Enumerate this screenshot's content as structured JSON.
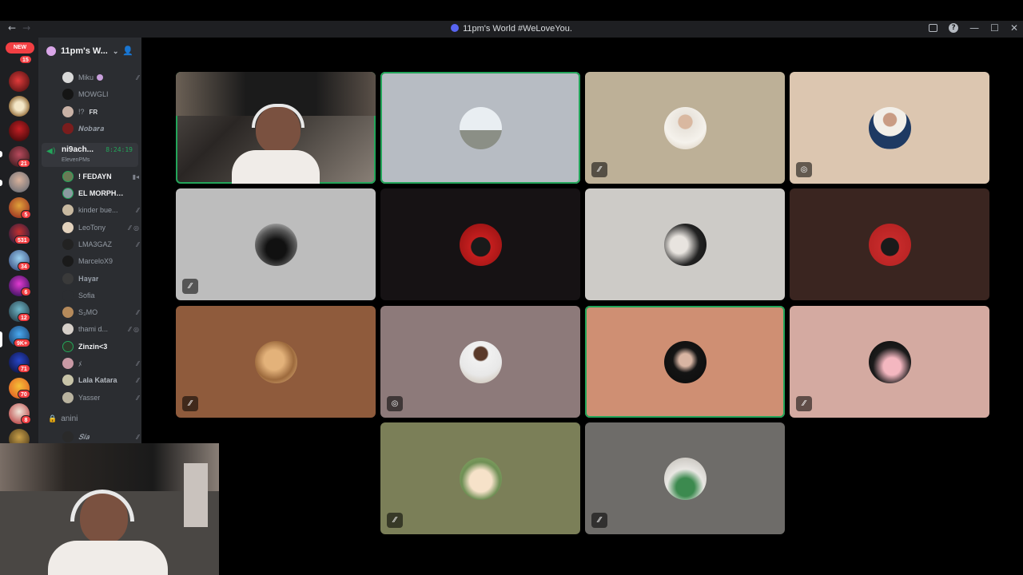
{
  "window": {
    "title": "11pm's World #WeLoveYou.",
    "back": "←",
    "forward": "→",
    "controls": {
      "inbox": "inbox-icon",
      "help": "?",
      "minimize": "—",
      "maximize": "☐",
      "close": "✕"
    }
  },
  "rail": {
    "new_badge": "NEW",
    "counts": [
      "15",
      "21",
      "5",
      "531",
      "34",
      "6",
      "12",
      "9K+",
      "71",
      "70",
      "8"
    ]
  },
  "server": {
    "name": "11pm's W...",
    "chevron": "⌄",
    "invite_icon": "add-user-icon"
  },
  "voice_users_top": [
    {
      "name": "Miku",
      "extra": "",
      "muted": true
    },
    {
      "name": "MOWGLI",
      "extra": "",
      "muted": false
    },
    {
      "name": "!?",
      "extra": "FR",
      "muted": false
    },
    {
      "name": "𝑵𝒐𝒃𝒂𝒓𝒂",
      "extra": "",
      "muted": false
    }
  ],
  "active_channel": {
    "name": "ni9ach...",
    "timer": "8:24:19",
    "subtitle": "ElevenPMs"
  },
  "voice_users": [
    {
      "name": "! FEDAYN",
      "bright": true,
      "icons": [
        "video-icon"
      ]
    },
    {
      "name": "EL MORPHO _",
      "bright": true,
      "icons": []
    },
    {
      "name": "kinder bue...",
      "bright": false,
      "icons": [
        "mic-muted-icon"
      ]
    },
    {
      "name": "LeoTony",
      "bright": false,
      "icons": [
        "mic-muted-icon",
        "deafened-icon"
      ]
    },
    {
      "name": "LMA3GAZ",
      "bright": false,
      "icons": [
        "mic-muted-icon"
      ]
    },
    {
      "name": "MarceloX9",
      "bright": false,
      "icons": []
    },
    {
      "name": "𝐇𝐚𝐲𝐚𝐫",
      "bright": false,
      "icons": []
    },
    {
      "name": "Sofia",
      "bright": false,
      "icons": []
    },
    {
      "name": "S₃MO",
      "bright": false,
      "icons": [
        "mic-muted-icon"
      ]
    },
    {
      "name": "thami d...",
      "bright": false,
      "icons": [
        "mic-muted-icon",
        "deafened-icon"
      ]
    },
    {
      "name": "Zinzin<3",
      "bright": true,
      "icons": []
    },
    {
      "name": "ﾒ",
      "bright": false,
      "icons": [
        "mic-muted-icon"
      ]
    },
    {
      "name": "Lala Katara",
      "bright": false,
      "icons": [
        "mic-muted-icon"
      ]
    },
    {
      "name": "Yasser",
      "bright": false,
      "icons": [
        "mic-muted-icon"
      ]
    }
  ],
  "locked_channel": {
    "name": "anini",
    "lock_icon": "lock-icon"
  },
  "bottom_user": {
    "name": "𝑺𝒊𝒂",
    "icon": "mic-muted-icon"
  },
  "tiles": [
    {
      "kind": "video",
      "speaking": true,
      "muted": false,
      "bg": "#3b3a36"
    },
    {
      "kind": "avatar",
      "speaking": true,
      "muted": false,
      "bg": "#b7bcc3"
    },
    {
      "kind": "avatar",
      "speaking": false,
      "muted": true,
      "bg": "#bdb097"
    },
    {
      "kind": "avatar",
      "speaking": false,
      "muted": true,
      "bg": "#dcc6b0",
      "deafened": true
    },
    {
      "kind": "avatar",
      "speaking": false,
      "muted": true,
      "bg": "#bdbdbd"
    },
    {
      "kind": "avatar",
      "speaking": false,
      "muted": false,
      "bg": "#161214"
    },
    {
      "kind": "avatar",
      "speaking": false,
      "muted": false,
      "bg": "#cdcbc7"
    },
    {
      "kind": "avatar",
      "speaking": false,
      "muted": false,
      "bg": "#3a2520"
    },
    {
      "kind": "avatar",
      "speaking": false,
      "muted": true,
      "bg": "#8f5b3c"
    },
    {
      "kind": "avatar",
      "speaking": false,
      "muted": true,
      "bg": "#8d7a7a",
      "deafened": true
    },
    {
      "kind": "avatar",
      "speaking": true,
      "muted": false,
      "bg": "#cf8f73"
    },
    {
      "kind": "avatar",
      "speaking": false,
      "muted": true,
      "bg": "#d4aaa1"
    },
    {
      "kind": "avatar",
      "speaking": false,
      "muted": true,
      "bg": "#7b7f58"
    },
    {
      "kind": "avatar",
      "speaking": false,
      "muted": true,
      "bg": "#6e6c69"
    }
  ],
  "colors": {
    "speaking": "#23a55a",
    "mention": "#f23f43",
    "rail": "#1e1f22",
    "sidebar": "#2b2d31"
  }
}
